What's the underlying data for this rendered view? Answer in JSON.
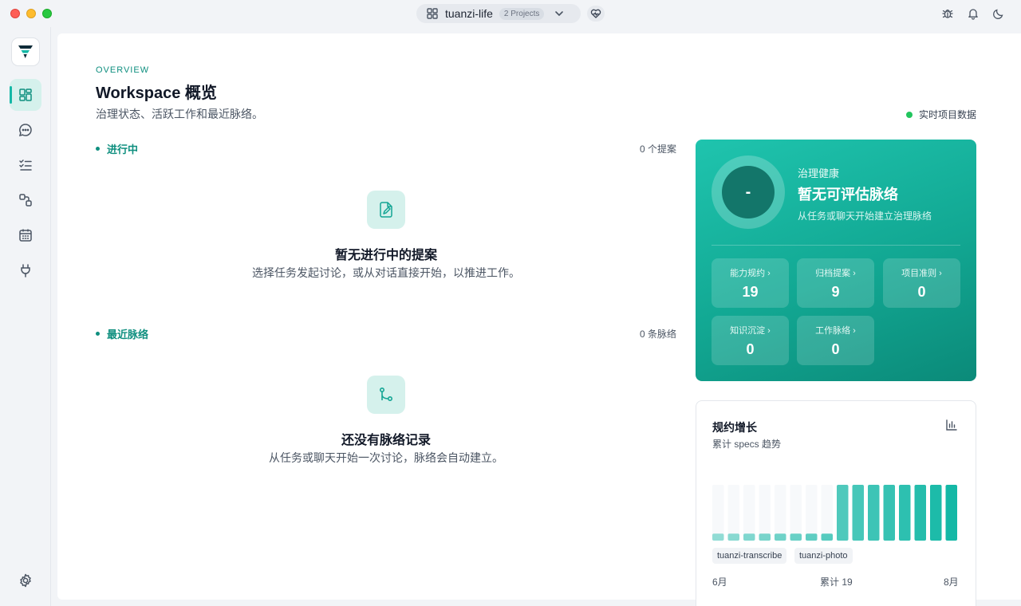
{
  "titlebar": {
    "project_name": "tuanzi-life",
    "projects_badge": "2 Projects",
    "icons": [
      "grid-icon",
      "chevron-down-icon",
      "heart-pulse-icon",
      "bug-icon",
      "bell-icon",
      "moon-icon"
    ]
  },
  "sidebar": {
    "items": [
      {
        "name": "dashboard",
        "icon": "dashboard-icon",
        "active": true
      },
      {
        "name": "chat",
        "icon": "chat-icon",
        "active": false
      },
      {
        "name": "tasks",
        "icon": "checklist-icon",
        "active": false
      },
      {
        "name": "workflow",
        "icon": "workflow-icon",
        "active": false
      },
      {
        "name": "calendar",
        "icon": "calendar-icon",
        "active": false
      },
      {
        "name": "plugins",
        "icon": "plug-icon",
        "active": false
      }
    ],
    "settings_icon": "gear-icon"
  },
  "header": {
    "eyebrow": "OVERVIEW",
    "title": "Workspace 概览",
    "subtitle": "治理状态、活跃工作和最近脉络。",
    "live_label": "实时项目数据"
  },
  "in_progress": {
    "title": "进行中",
    "count": "0 个提案",
    "empty_title": "暂无进行中的提案",
    "empty_desc": "选择任务发起讨论，或从对话直接开始，以推进工作。"
  },
  "recent": {
    "title": "最近脉络",
    "count": "0 条脉络",
    "empty_title": "还没有脉络记录",
    "empty_desc": "从任务或聊天开始一次讨论，脉络会自动建立。"
  },
  "health": {
    "score": "-",
    "label": "治理健康",
    "title": "暂无可评估脉络",
    "subtitle": "从任务或聊天开始建立治理脉络",
    "stats": [
      {
        "label": "能力规约",
        "value": "19"
      },
      {
        "label": "归档提案",
        "value": "9"
      },
      {
        "label": "项目准则",
        "value": "0"
      },
      {
        "label": "知识沉淀",
        "value": "0"
      },
      {
        "label": "工作脉络",
        "value": "0"
      }
    ],
    "colors": {
      "gradient_start": "#1fc4ae",
      "gradient_end": "#0b8a79"
    }
  },
  "growth": {
    "title": "规约增长",
    "subtitle": "累计 specs 趋势",
    "legend": [
      "tuanzi-transcribe",
      "tuanzi-photo"
    ],
    "x_start": "6月",
    "total": "累计 19",
    "x_end": "8月"
  },
  "chart_data": {
    "type": "bar",
    "title": "规约增长",
    "series": [
      {
        "name": "tuanzi-transcribe",
        "values": [
          1,
          1,
          1,
          1,
          1,
          1,
          1,
          1,
          8,
          8,
          8,
          8,
          8,
          8,
          8,
          8
        ]
      }
    ],
    "ylim": [
      0,
      8
    ]
  }
}
